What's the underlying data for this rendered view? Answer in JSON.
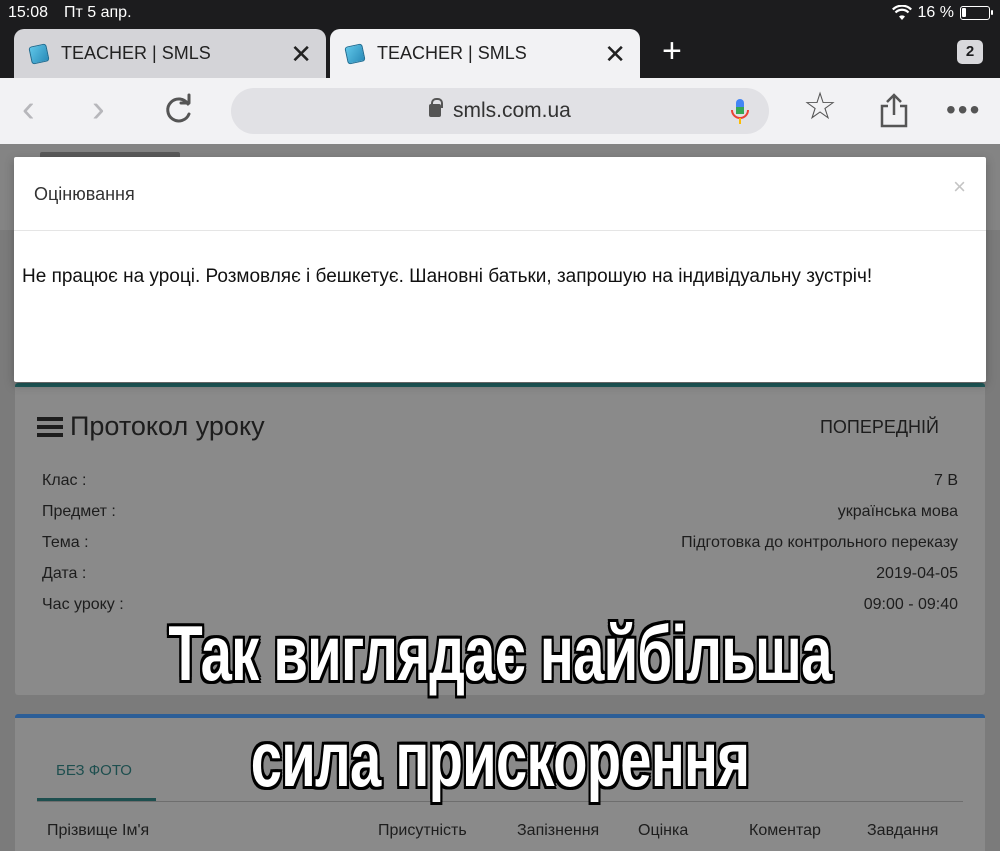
{
  "status_bar": {
    "time": "15:08",
    "date": "Пт 5 апр.",
    "battery": "16 %"
  },
  "tabs": [
    {
      "title": "TEACHER | SMLS",
      "active": false
    },
    {
      "title": "TEACHER | SMLS",
      "active": true
    }
  ],
  "tab_count": "2",
  "address_bar": {
    "url": "smls.com.ua"
  },
  "modal": {
    "title": "Оцінювання",
    "close": "×",
    "body": "Не працює на уроці. Розмовляє і бешкетує. Шановні батьки, запрошую на індивідуальну зустріч!"
  },
  "protocol": {
    "title": "Протокол уроку",
    "prev_button": "ПОПЕРЕДНІЙ",
    "rows": [
      {
        "label": "Клас :",
        "value": "7 В"
      },
      {
        "label": "Предмет :",
        "value": "українська мова"
      },
      {
        "label": "Тема :",
        "value": "Підготовка до контрольного переказу"
      },
      {
        "label": "Дата :",
        "value": "2019-04-05"
      },
      {
        "label": "Час уроку :",
        "value": "09:00 - 09:40"
      }
    ]
  },
  "students": {
    "tab_label": "БЕЗ ФОТО",
    "columns": [
      "Прізвище Ім'я",
      "Присутність",
      "Запізнення",
      "Оцінка",
      "Коментар",
      "Завдання"
    ]
  },
  "caption": {
    "line1": "Так виглядає найбільша",
    "line2": "сила прискорення"
  },
  "colors": {
    "overlay_page": "#7b7b7b",
    "protocol_accent": "#1f5a5a",
    "students_accent": "#2c5e97"
  }
}
